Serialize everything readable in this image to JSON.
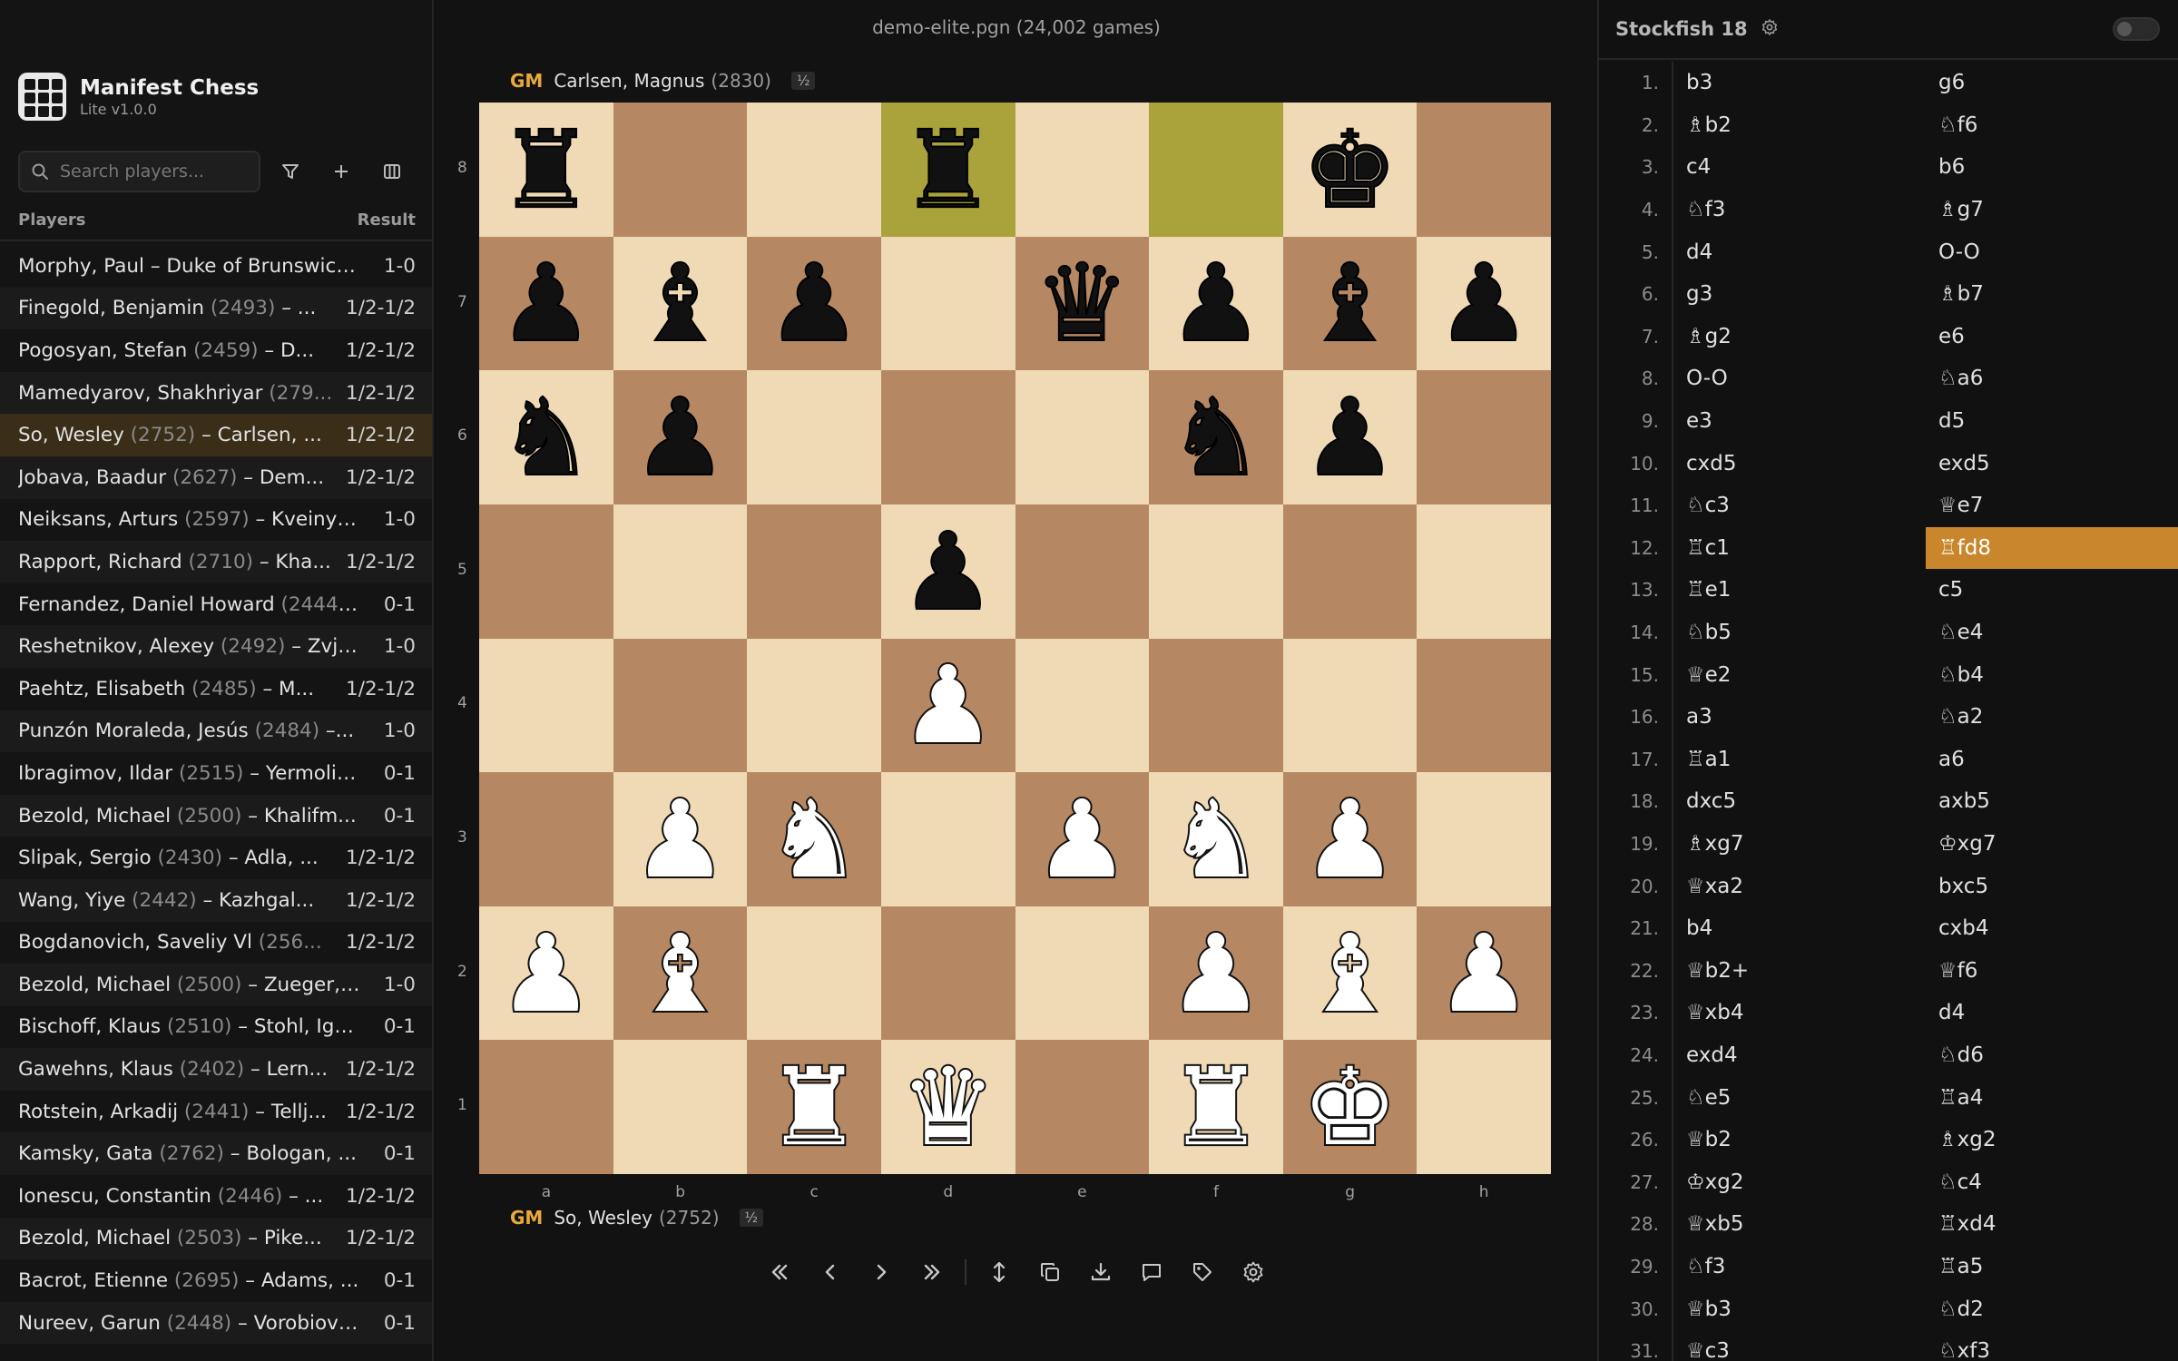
{
  "app": {
    "name": "Manifest Chess",
    "version": "Lite v1.0.0"
  },
  "search": {
    "placeholder": "Search players..."
  },
  "list_header": {
    "players": "Players",
    "result": "Result"
  },
  "games": [
    {
      "white": "Morphy, Paul",
      "rest": " – Duke of Brunswick...",
      "rating": "",
      "result": "1-0"
    },
    {
      "white": "Finegold, Benjamin",
      "rating": "(2493)",
      "rest": " – ...",
      "result": "1/2-1/2"
    },
    {
      "white": "Pogosyan, Stefan",
      "rating": "(2459)",
      "rest": " – D...",
      "result": "1/2-1/2"
    },
    {
      "white": "Mamedyarov, Shakhriyar",
      "rating": "(279...",
      "rest": "",
      "result": "1/2-1/2"
    },
    {
      "white": "So, Wesley",
      "rating": "(2752)",
      "rest": " – Carlsen, ...",
      "result": "1/2-1/2"
    },
    {
      "white": "Jobava, Baadur",
      "rating": "(2627)",
      "rest": " – Dem...",
      "result": "1/2-1/2"
    },
    {
      "white": "Neiksans, Arturs",
      "rating": "(2597)",
      "rest": " – Kveinys...",
      "result": "1-0"
    },
    {
      "white": "Rapport, Richard",
      "rating": "(2710)",
      "rest": " – Kha...",
      "result": "1/2-1/2"
    },
    {
      "white": "Fernandez, Daniel Howard",
      "rating": "(2444)...",
      "rest": "",
      "result": "0-1"
    },
    {
      "white": "Reshetnikov, Alexey",
      "rating": "(2492)",
      "rest": " – Zvja...",
      "result": "1-0"
    },
    {
      "white": "Paehtz, Elisabeth",
      "rating": "(2485)",
      "rest": " – M...",
      "result": "1/2-1/2"
    },
    {
      "white": "Punzón Moraleda, Jesús",
      "rating": "(2484)",
      "rest": " –...",
      "result": "1-0"
    },
    {
      "white": "Ibragimov, Ildar",
      "rating": "(2515)",
      "rest": " – Yermolin...",
      "result": "0-1"
    },
    {
      "white": "Bezold, Michael",
      "rating": "(2500)",
      "rest": " – Khalifm...",
      "result": "0-1"
    },
    {
      "white": "Slipak, Sergio",
      "rating": "(2430)",
      "rest": " – Adla, ...",
      "result": "1/2-1/2"
    },
    {
      "white": "Wang, Yiye",
      "rating": "(2442)",
      "rest": " – Kazhgal...",
      "result": "1/2-1/2"
    },
    {
      "white": "Bogdanovich, Saveliy Vl",
      "rating": "(256...",
      "rest": "",
      "result": "1/2-1/2"
    },
    {
      "white": "Bezold, Michael",
      "rating": "(2500)",
      "rest": " – Zueger, ...",
      "result": "1-0"
    },
    {
      "white": "Bischoff, Klaus",
      "rating": "(2510)",
      "rest": " – Stohl, Igo...",
      "result": "0-1"
    },
    {
      "white": "Gawehns, Klaus",
      "rating": "(2402)",
      "rest": " – Lern...",
      "result": "1/2-1/2"
    },
    {
      "white": "Rotstein, Arkadij",
      "rating": "(2441)",
      "rest": " – Tellj...",
      "result": "1/2-1/2"
    },
    {
      "white": "Kamsky, Gata",
      "rating": "(2762)",
      "rest": " – Bologan, ...",
      "result": "0-1"
    },
    {
      "white": "Ionescu, Constantin",
      "rating": "(2446)",
      "rest": " – ...",
      "result": "1/2-1/2"
    },
    {
      "white": "Bezold, Michael",
      "rating": "(2503)",
      "rest": " – Pike...",
      "result": "1/2-1/2"
    },
    {
      "white": "Bacrot, Etienne",
      "rating": "(2695)",
      "rest": " – Adams, ...",
      "result": "0-1"
    },
    {
      "white": "Nureev, Garun",
      "rating": "(2448)",
      "rest": " – Vorobiov,...",
      "result": "0-1"
    }
  ],
  "selected_game_index": 4,
  "database": {
    "title": "demo-elite.pgn (24,002 games)"
  },
  "top_player": {
    "title": "GM",
    "name": "Carlsen, Magnus",
    "rating": "(2830)",
    "score": "½"
  },
  "bottom_player": {
    "title": "GM",
    "name": "So, Wesley",
    "rating": "(2752)",
    "score": "½"
  },
  "board": {
    "ranks": [
      "8",
      "7",
      "6",
      "5",
      "4",
      "3",
      "2",
      "1"
    ],
    "files": [
      "a",
      "b",
      "c",
      "d",
      "e",
      "f",
      "g",
      "h"
    ],
    "position": [
      [
        "r",
        "",
        "",
        "r",
        "",
        "",
        "k",
        ""
      ],
      [
        "p",
        "b",
        "p",
        "",
        "q",
        "p",
        "b",
        "p"
      ],
      [
        "n",
        "p",
        "",
        "",
        "",
        "n",
        "p",
        ""
      ],
      [
        "",
        "",
        "",
        "p",
        "",
        "",
        "",
        ""
      ],
      [
        "",
        "",
        "",
        "P",
        "",
        "",
        "",
        ""
      ],
      [
        "",
        "P",
        "N",
        "",
        "P",
        "N",
        "P",
        ""
      ],
      [
        "P",
        "B",
        "",
        "",
        "",
        "P",
        "B",
        "P"
      ],
      [
        "",
        "",
        "R",
        "Q",
        "",
        "R",
        "K",
        ""
      ]
    ],
    "last_move": [
      "d8",
      "f8"
    ]
  },
  "engine": {
    "name": "Stockfish 18"
  },
  "moves": [
    [
      "b3",
      "g6"
    ],
    [
      "♗b2",
      "♘f6"
    ],
    [
      "c4",
      "b6"
    ],
    [
      "♘f3",
      "♗g7"
    ],
    [
      "d4",
      "O-O"
    ],
    [
      "g3",
      "♗b7"
    ],
    [
      "♗g2",
      "e6"
    ],
    [
      "O-O",
      "♘a6"
    ],
    [
      "e3",
      "d5"
    ],
    [
      "cxd5",
      "exd5"
    ],
    [
      "♘c3",
      "♕e7"
    ],
    [
      "♖c1",
      "♖fd8"
    ],
    [
      "♖e1",
      "c5"
    ],
    [
      "♘b5",
      "♘e4"
    ],
    [
      "♕e2",
      "♘b4"
    ],
    [
      "a3",
      "♘a2"
    ],
    [
      "♖a1",
      "a6"
    ],
    [
      "dxc5",
      "axb5"
    ],
    [
      "♗xg7",
      "♔xg7"
    ],
    [
      "♕xa2",
      "bxc5"
    ],
    [
      "b4",
      "cxb4"
    ],
    [
      "♕b2+",
      "♕f6"
    ],
    [
      "♕xb4",
      "d4"
    ],
    [
      "exd4",
      "♘d6"
    ],
    [
      "♘e5",
      "♖a4"
    ],
    [
      "♕b2",
      "♗xg2"
    ],
    [
      "♔xg2",
      "♘c4"
    ],
    [
      "♕xb5",
      "♖xd4"
    ],
    [
      "♘f3",
      "♖a5"
    ],
    [
      "♕b3",
      "♘d2"
    ],
    [
      "♕c3",
      "♘xf3"
    ]
  ],
  "current_move": {
    "number": 12,
    "side": "black"
  }
}
